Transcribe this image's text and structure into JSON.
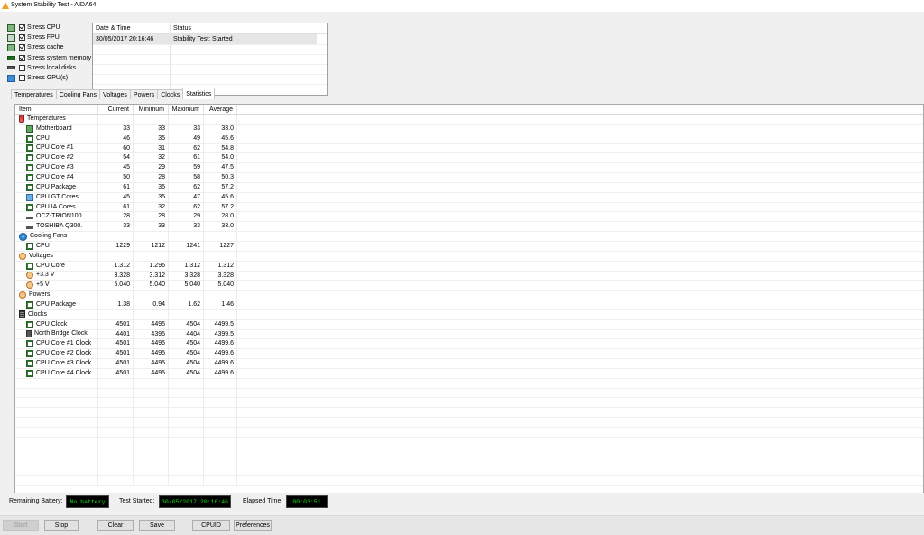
{
  "window": {
    "title": "System Stability Test - AIDA64"
  },
  "stress_options": [
    {
      "label": "Stress CPU",
      "checked": true,
      "icon": "cpu-chip-icon"
    },
    {
      "label": "Stress FPU",
      "checked": true,
      "icon": "fpu-chip-icon"
    },
    {
      "label": "Stress cache",
      "checked": true,
      "icon": "cache-chip-icon"
    },
    {
      "label": "Stress system memory",
      "checked": true,
      "icon": "memory-module-icon"
    },
    {
      "label": "Stress local disks",
      "checked": false,
      "icon": "disk-drive-icon"
    },
    {
      "label": "Stress GPU(s)",
      "checked": false,
      "icon": "monitor-icon"
    }
  ],
  "status_log": {
    "columns": [
      "Date & Time",
      "Status"
    ],
    "rows": [
      {
        "datetime": "30/05/2017 20:16:46",
        "status": "Stability Test: Started"
      }
    ]
  },
  "tabs": [
    {
      "label": "Temperatures",
      "active": false
    },
    {
      "label": "Cooling Fans",
      "active": false
    },
    {
      "label": "Voltages",
      "active": false
    },
    {
      "label": "Powers",
      "active": false
    },
    {
      "label": "Clocks",
      "active": false
    },
    {
      "label": "Statistics",
      "active": true
    }
  ],
  "table": {
    "columns": [
      "Item",
      "Current",
      "Minimum",
      "Maximum",
      "Average"
    ],
    "rows": [
      {
        "type": "group",
        "icon": "thermometer-icon",
        "label": "Temperatures"
      },
      {
        "type": "item",
        "icon": "motherboard-icon",
        "label": "Motherboard",
        "current": "33",
        "minimum": "33",
        "maximum": "33",
        "average": "33.0"
      },
      {
        "type": "item",
        "icon": "chip-icon",
        "label": "CPU",
        "current": "46",
        "minimum": "35",
        "maximum": "49",
        "average": "45.6"
      },
      {
        "type": "item",
        "icon": "chip-icon",
        "label": "CPU Core #1",
        "current": "60",
        "minimum": "31",
        "maximum": "62",
        "average": "54.8"
      },
      {
        "type": "item",
        "icon": "chip-icon",
        "label": "CPU Core #2",
        "current": "54",
        "minimum": "32",
        "maximum": "61",
        "average": "54.0"
      },
      {
        "type": "item",
        "icon": "chip-icon",
        "label": "CPU Core #3",
        "current": "45",
        "minimum": "29",
        "maximum": "59",
        "average": "47.5"
      },
      {
        "type": "item",
        "icon": "chip-icon",
        "label": "CPU Core #4",
        "current": "50",
        "minimum": "28",
        "maximum": "58",
        "average": "50.3"
      },
      {
        "type": "item",
        "icon": "chip-icon",
        "label": "CPU Package",
        "current": "61",
        "minimum": "35",
        "maximum": "62",
        "average": "57.2"
      },
      {
        "type": "item",
        "icon": "gpu-icon",
        "label": "CPU GT Cores",
        "current": "45",
        "minimum": "35",
        "maximum": "47",
        "average": "45.6"
      },
      {
        "type": "item",
        "icon": "chip-icon",
        "label": "CPU IA Cores",
        "current": "61",
        "minimum": "32",
        "maximum": "62",
        "average": "57.2"
      },
      {
        "type": "item",
        "icon": "disk-icon",
        "label": "OCZ-TRION100",
        "current": "28",
        "minimum": "28",
        "maximum": "29",
        "average": "28.0"
      },
      {
        "type": "item",
        "icon": "disk-icon",
        "label": "TOSHIBA Q300.",
        "current": "33",
        "minimum": "33",
        "maximum": "33",
        "average": "33.0"
      },
      {
        "type": "group",
        "icon": "fan-icon",
        "label": "Cooling Fans"
      },
      {
        "type": "item",
        "icon": "chip-icon",
        "label": "CPU",
        "current": "1229",
        "minimum": "1212",
        "maximum": "1241",
        "average": "1227"
      },
      {
        "type": "group",
        "icon": "voltage-icon",
        "label": "Voltages"
      },
      {
        "type": "item",
        "icon": "chip-icon",
        "label": "CPU Core",
        "current": "1.312",
        "minimum": "1.296",
        "maximum": "1.312",
        "average": "1.312"
      },
      {
        "type": "item",
        "icon": "voltage-icon",
        "label": "+3.3 V",
        "current": "3.328",
        "minimum": "3.312",
        "maximum": "3.328",
        "average": "3.328"
      },
      {
        "type": "item",
        "icon": "voltage-icon",
        "label": "+5 V",
        "current": "5.040",
        "minimum": "5.040",
        "maximum": "5.040",
        "average": "5.040"
      },
      {
        "type": "group",
        "icon": "power-icon",
        "label": "Powers"
      },
      {
        "type": "item",
        "icon": "chip-icon",
        "label": "CPU Package",
        "current": "1.38",
        "minimum": "0.94",
        "maximum": "1.62",
        "average": "1.46"
      },
      {
        "type": "group",
        "icon": "clock-icon",
        "label": "Clocks"
      },
      {
        "type": "item",
        "icon": "chip-icon",
        "label": "CPU Clock",
        "current": "4501",
        "minimum": "4495",
        "maximum": "4504",
        "average": "4499.5"
      },
      {
        "type": "item",
        "icon": "northbridge-icon",
        "label": "North Bridge Clock",
        "current": "4401",
        "minimum": "4395",
        "maximum": "4404",
        "average": "4399.5"
      },
      {
        "type": "item",
        "icon": "chip-icon",
        "label": "CPU Core #1 Clock",
        "current": "4501",
        "minimum": "4495",
        "maximum": "4504",
        "average": "4499.6"
      },
      {
        "type": "item",
        "icon": "chip-icon",
        "label": "CPU Core #2 Clock",
        "current": "4501",
        "minimum": "4495",
        "maximum": "4504",
        "average": "4499.6"
      },
      {
        "type": "item",
        "icon": "chip-icon",
        "label": "CPU Core #3 Clock",
        "current": "4501",
        "minimum": "4495",
        "maximum": "4504",
        "average": "4499.6"
      },
      {
        "type": "item",
        "icon": "chip-icon",
        "label": "CPU Core #4 Clock",
        "current": "4501",
        "minimum": "4495",
        "maximum": "4504",
        "average": "4499.6"
      }
    ]
  },
  "status_bar": {
    "battery_label": "Remaining Battery:",
    "battery_value": "No battery",
    "started_label": "Test Started:",
    "started_value": "30/05/2017 20:16:46",
    "elapsed_label": "Elapsed Time:",
    "elapsed_value": "00:03:51"
  },
  "buttons": {
    "start": "Start",
    "stop": "Stop",
    "clear": "Clear",
    "save": "Save",
    "cpuid": "CPUID",
    "preferences": "Preferences"
  },
  "colors": {
    "lcd_text": "#11e011",
    "lcd_bg": "#000000",
    "selection": "#e6e6e6"
  }
}
